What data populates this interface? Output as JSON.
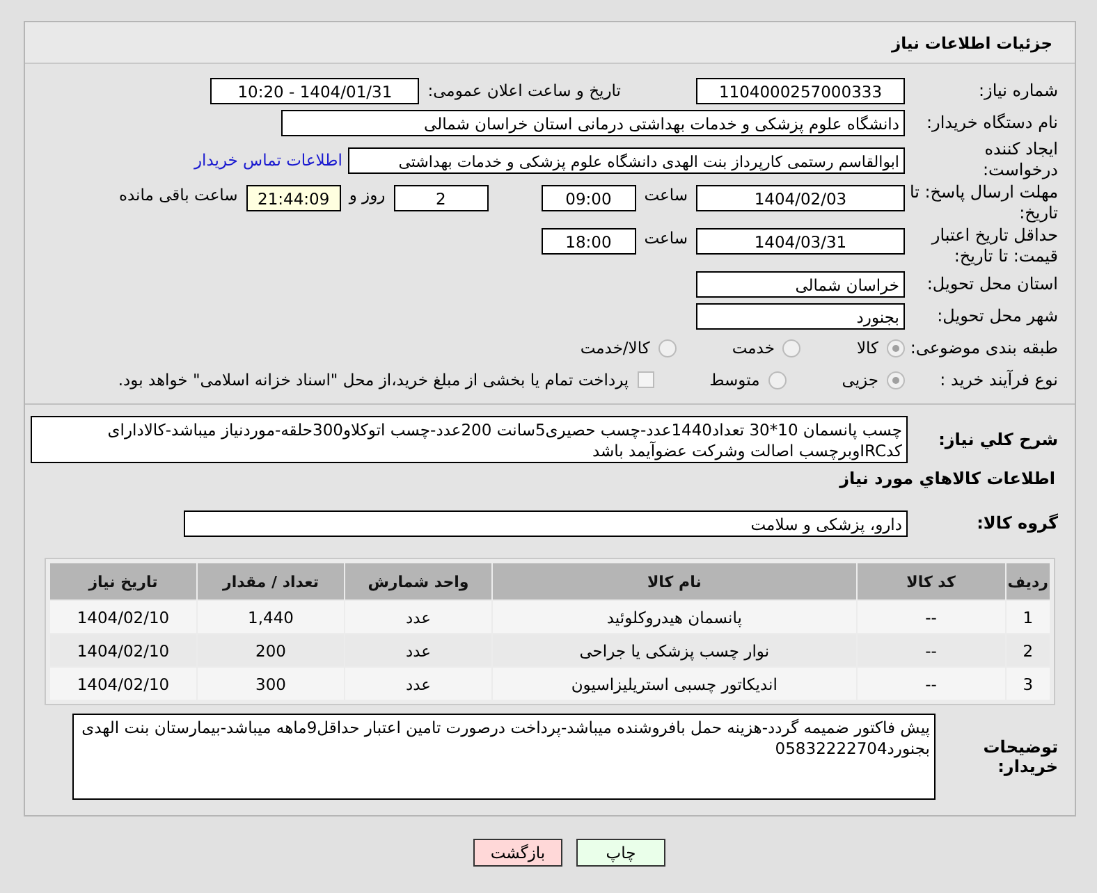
{
  "header": {
    "title": "جزئیات اطلاعات نیاز"
  },
  "need_number": {
    "label": "شماره نیاز:",
    "value": "1104000257000333"
  },
  "announce": {
    "label": "تاریخ و ساعت اعلان عمومی:",
    "value": "1404/01/31 - 10:20"
  },
  "buyer_org": {
    "label": "نام دستگاه خریدار:",
    "value": "دانشگاه علوم پزشکی و خدمات بهداشتی درمانی استان خراسان شمالی"
  },
  "creator": {
    "label": "ایجاد کننده درخواست:",
    "value": "ابوالقاسم رستمی کارپرداز بنت الهدی دانشگاه علوم پزشکی و خدمات بهداشتی",
    "link": "اطلاعات تماس خریدار"
  },
  "deadline": {
    "label": "مهلت ارسال پاسخ: تا تاریخ:",
    "date": "1404/02/03",
    "time_label": "ساعت",
    "time": "09:00",
    "days": "2",
    "days_label": "روز و",
    "remaining": "21:44:09",
    "remaining_label": "ساعت باقی مانده"
  },
  "validity": {
    "label": "حداقل تاریخ اعتبار قیمت: تا تاریخ:",
    "date": "1404/03/31",
    "time_label": "ساعت",
    "time": "18:00"
  },
  "province": {
    "label": "استان محل تحویل:",
    "value": "خراسان شمالی"
  },
  "city": {
    "label": "شهر محل تحویل:",
    "value": "بجنورد"
  },
  "category": {
    "label": "طبقه بندی موضوعی:",
    "options": [
      {
        "label": "کالا",
        "selected": true
      },
      {
        "label": "خدمت",
        "selected": false
      },
      {
        "label": "کالا/خدمت",
        "selected": false
      }
    ]
  },
  "process": {
    "label": "نوع فرآیند خرید :",
    "options": [
      {
        "label": "جزیی",
        "selected": true
      },
      {
        "label": "متوسط",
        "selected": false
      }
    ],
    "payment": {
      "label": "پرداخت تمام یا بخشی از مبلغ خرید،از محل \"اسناد خزانه اسلامی\" خواهد بود.",
      "checked": false
    }
  },
  "description": {
    "label": "شرح کلي نیاز:",
    "value": "چسب پانسمان 10*30 تعداد1440عدد-چسب حصیری5سانت 200عدد-چسب اتوکلاو300حلقه-موردنیاز میباشد-کالادارای کدIRCوبرچسب اصالت وشرکت عضوآیمد باشد"
  },
  "goods_heading": "اطلاعات کالاهاي مورد نیاز",
  "goods_group": {
    "label": "گروه کالا:",
    "value": "دارو، پزشکی و سلامت"
  },
  "table": {
    "columns": [
      "ردیف",
      "کد کالا",
      "نام کالا",
      "واحد شمارش",
      "تعداد / مقدار",
      "تاریخ نیاز"
    ],
    "rows": [
      [
        "1",
        "--",
        "پانسمان هیدروکلوئید",
        "عدد",
        "1,440",
        "1404/02/10"
      ],
      [
        "2",
        "--",
        "نوار چسب پزشکی یا جراحی",
        "عدد",
        "200",
        "1404/02/10"
      ],
      [
        "3",
        "--",
        "اندیکاتور چسبی استریلیزاسیون",
        "عدد",
        "300",
        "1404/02/10"
      ]
    ]
  },
  "buyer_notes": {
    "label": "توضیحات خریدار:",
    "value": "پیش فاکتور ضمیمه گردد-هزینه حمل بافروشنده میباشد-پرداخت درصورت تامین اعتبار حداقل9ماهه میباشد-بیمارستان بنت الهدی بجنورد05832222704"
  },
  "buttons": [
    {
      "label": "چاپ",
      "kind": "print"
    },
    {
      "label": "بازگشت",
      "kind": "back"
    }
  ]
}
